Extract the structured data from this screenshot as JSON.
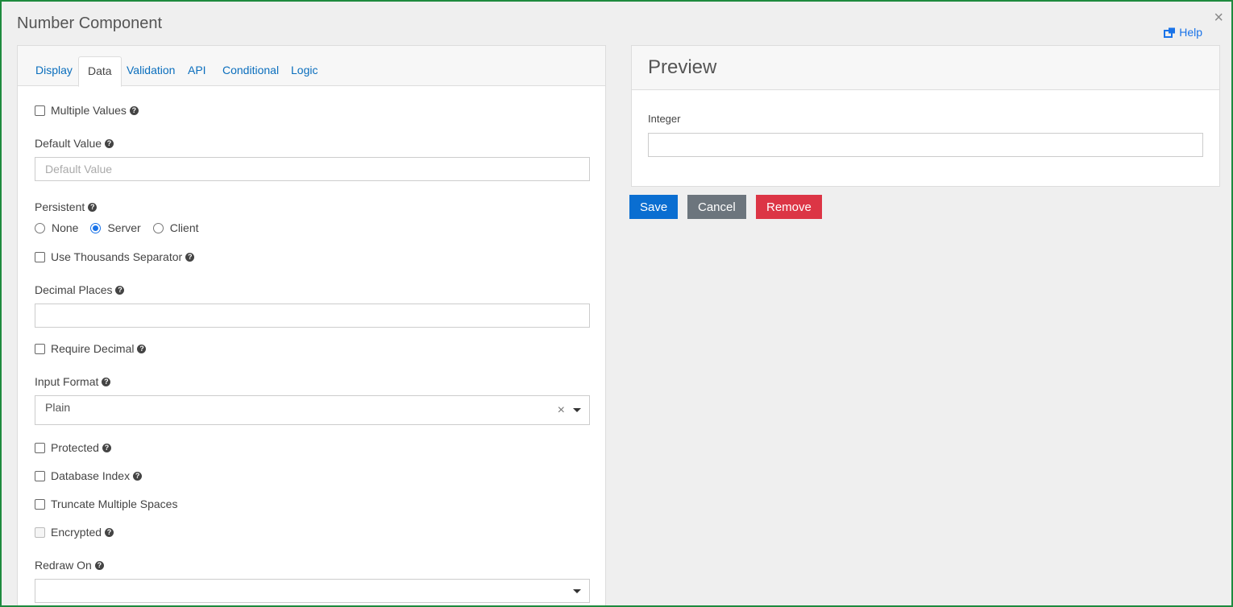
{
  "dialog": {
    "title": "Number Component",
    "close_label": "×",
    "help_label": "Help"
  },
  "tabs": [
    {
      "label": "Display",
      "active": false
    },
    {
      "label": "Data",
      "active": true
    },
    {
      "label": "Validation",
      "active": false
    },
    {
      "label": "API",
      "active": false
    },
    {
      "label": "Conditional",
      "active": false
    },
    {
      "label": "Logic",
      "active": false
    }
  ],
  "fields": {
    "multiple_values": {
      "label": "Multiple Values",
      "checked": false
    },
    "default_value": {
      "label": "Default Value",
      "placeholder": "Default Value",
      "value": ""
    },
    "persistent": {
      "label": "Persistent",
      "options": [
        {
          "label": "None",
          "checked": false
        },
        {
          "label": "Server",
          "checked": true
        },
        {
          "label": "Client",
          "checked": false
        }
      ]
    },
    "thousands_separator": {
      "label": "Use Thousands Separator",
      "checked": false
    },
    "decimal_places": {
      "label": "Decimal Places",
      "value": ""
    },
    "require_decimal": {
      "label": "Require Decimal",
      "checked": false
    },
    "input_format": {
      "label": "Input Format",
      "value": "Plain",
      "clear_label": "×"
    },
    "protected": {
      "label": "Protected",
      "checked": false
    },
    "database_index": {
      "label": "Database Index",
      "checked": false
    },
    "truncate_spaces": {
      "label": "Truncate Multiple Spaces",
      "checked": false
    },
    "encrypted": {
      "label": "Encrypted",
      "checked": false,
      "disabled": true
    },
    "redraw_on": {
      "label": "Redraw On",
      "value": ""
    }
  },
  "preview": {
    "title": "Preview",
    "field_label": "Integer",
    "field_value": ""
  },
  "actions": {
    "save": "Save",
    "cancel": "Cancel",
    "remove": "Remove"
  },
  "colors": {
    "frame_border": "#1e8a3e",
    "link_blue": "#0a6ebd",
    "save_bg": "#0a6ed1",
    "cancel_bg": "#6c757d",
    "remove_bg": "#dc3545"
  }
}
